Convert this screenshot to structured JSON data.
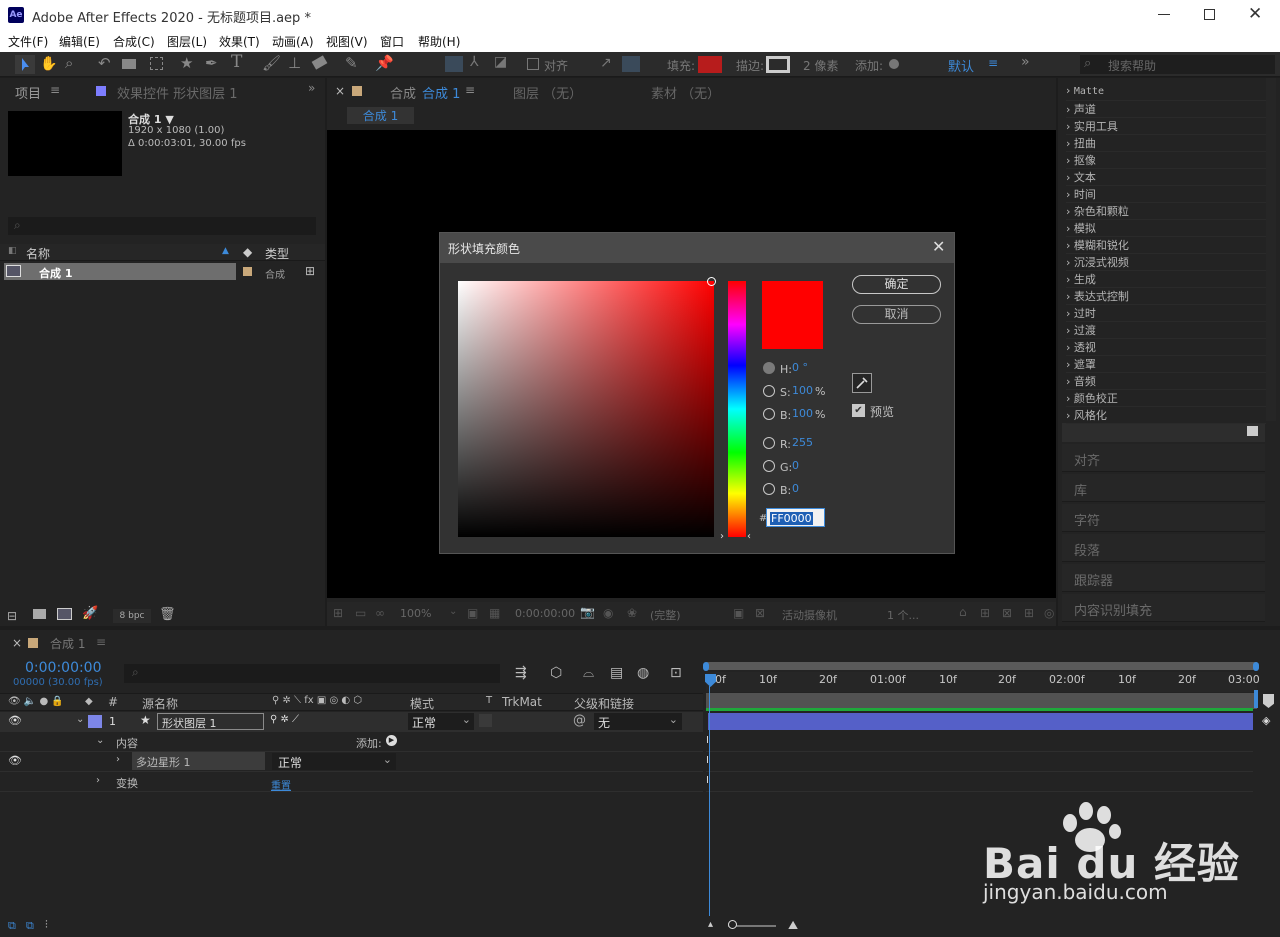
{
  "window": {
    "title": "Adobe After Effects 2020 - 无标题项目.aep *",
    "app_icon": "Ae"
  },
  "menu": [
    "文件(F)",
    "编辑(E)",
    "合成(C)",
    "图层(L)",
    "效果(T)",
    "动画(A)",
    "视图(V)",
    "窗口",
    "帮助(H)"
  ],
  "toolbar": {
    "align": "对齐",
    "fill": "填充:",
    "stroke": "描边:",
    "stroke_size": "2 像素",
    "add": "添加:",
    "workspace": "默认",
    "search_placeholder": "搜索帮助",
    "fill_color": "#b71c1c"
  },
  "project": {
    "tab": "项目",
    "tab_menu": "≡",
    "effects_tab": "效果控件 形状图层 1",
    "comp_name": "合成 1 ▼",
    "comp_size": "1920 x 1080 (1.00)",
    "comp_duration": "Δ 0:00:03:01, 30.00 fps",
    "col_name": "名称",
    "col_type": "类型",
    "item_name": "合成 1",
    "item_type": "合成",
    "bpc": "8 bpc"
  },
  "viewer": {
    "tab_close": "×",
    "tab_label": "合成",
    "tab_active": "合成 1",
    "tab_menu": "≡",
    "layer_tab": "图层 （无）",
    "footage_tab": "素材 （无）",
    "sub_tab": "合成 1",
    "zoom": "100%",
    "timecode": "0:00:00:00",
    "quality": "(完整)",
    "camera": "活动摄像机",
    "views": "1 个..."
  },
  "effects_list": [
    "Matte",
    "声道",
    "实用工具",
    "扭曲",
    "抠像",
    "文本",
    "时间",
    "杂色和颗粒",
    "模拟",
    "模糊和锐化",
    "沉浸式视频",
    "生成",
    "表达式控制",
    "过时",
    "过渡",
    "透视",
    "遮罩",
    "音频",
    "颜色校正",
    "风格化"
  ],
  "side_tabs": [
    "对齐",
    "库",
    "字符",
    "段落",
    "跟踪器",
    "内容识别填充"
  ],
  "dialog": {
    "title": "形状填充颜色",
    "ok": "确定",
    "cancel": "取消",
    "preview": "预览",
    "h_label": "H:",
    "h_value": "0 °",
    "s_label": "S:",
    "s_value": "100",
    "s_unit": "%",
    "b_label": "B:",
    "b_value": "100",
    "b_unit": "%",
    "r_label": "R:",
    "r_value": "255",
    "g_label": "G:",
    "g_value": "0",
    "bl_label": "B:",
    "bl_value": "0",
    "hex_label": "#",
    "hex_value": "FF0000",
    "color": "#ff0000"
  },
  "timeline": {
    "tab": "合成 1",
    "timecode": "0:00:00:00",
    "frames": "00000 (30.00 fps)",
    "search_placeholder": "",
    "ruler": [
      "00f",
      "10f",
      "20f",
      "01:00f",
      "10f",
      "20f",
      "02:00f",
      "10f",
      "20f",
      "03:00"
    ],
    "columns": {
      "num": "#",
      "source": "源名称",
      "mode": "模式",
      "t": "T",
      "trkmat": "TrkMat",
      "parent": "父级和链接"
    },
    "layer": {
      "num": "1",
      "name": "形状图层 1",
      "mode": "正常",
      "parent": "无"
    },
    "contents": "内容",
    "add": "添加:",
    "polystar": "多边星形 1",
    "poly_mode": "正常",
    "transform": "变换",
    "reset": "重置"
  },
  "watermark": {
    "logo": "Bai du 经验",
    "url": "jingyan.baidu.com"
  }
}
